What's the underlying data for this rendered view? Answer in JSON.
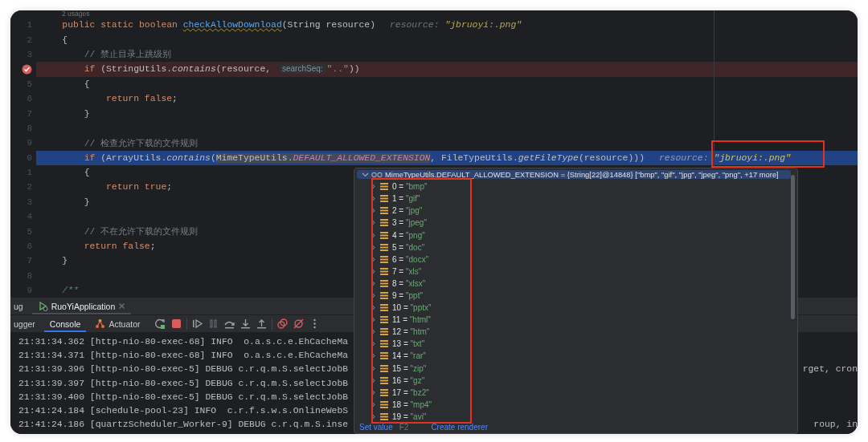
{
  "editor": {
    "usages_hint": "2 usages",
    "lines": [
      {
        "number": "1",
        "breakpoint": false,
        "current": false,
        "tokens": [
          {
            "kind": "keyword",
            "text": "    public static boolean "
          },
          {
            "kind": "declaration",
            "text": "checkAllowDownload"
          },
          {
            "kind": "plain",
            "text": "(String resource)"
          }
        ],
        "inline_value": {
          "name": "resource:",
          "value": "\"jbruoyi:.png\""
        }
      },
      {
        "number": "2",
        "breakpoint": false,
        "current": false,
        "tokens": [
          {
            "kind": "plain",
            "text": "    {"
          }
        ]
      },
      {
        "number": "3",
        "breakpoint": false,
        "current": false,
        "tokens": [
          {
            "kind": "comment",
            "text": "        // 禁止目录上跳级别"
          }
        ]
      },
      {
        "breakpoint": true,
        "current": false,
        "tokens": [
          {
            "kind": "keyword",
            "text": "        if"
          },
          {
            "kind": "plain",
            "text": " (StringUtils."
          },
          {
            "kind": "call",
            "text": "contains"
          },
          {
            "kind": "plain",
            "text": "(resource, "
          },
          {
            "kind": "param-hint",
            "text": "searchSeq:"
          },
          {
            "kind": "string",
            "text": "\"..\""
          },
          {
            "kind": "plain",
            "text": "))"
          }
        ]
      },
      {
        "number": "5",
        "breakpoint": false,
        "current": false,
        "tokens": [
          {
            "kind": "plain",
            "text": "        {"
          }
        ]
      },
      {
        "number": "6",
        "breakpoint": false,
        "current": false,
        "tokens": [
          {
            "kind": "keyword",
            "text": "            return false"
          },
          {
            "kind": "plain",
            "text": ";"
          }
        ]
      },
      {
        "number": "7",
        "breakpoint": false,
        "current": false,
        "tokens": [
          {
            "kind": "plain",
            "text": "        }"
          }
        ]
      },
      {
        "number": "8",
        "breakpoint": false,
        "current": false
      },
      {
        "number": "9",
        "breakpoint": false,
        "current": false,
        "tokens": [
          {
            "kind": "comment",
            "text": "        // 检查允许下载的文件规则"
          }
        ]
      },
      {
        "number": "0",
        "breakpoint": false,
        "current": true,
        "tokens": [
          {
            "kind": "keyword",
            "text": "        if"
          },
          {
            "kind": "plain",
            "text": " (ArrayUtils."
          },
          {
            "kind": "call",
            "text": "contains"
          },
          {
            "kind": "plain",
            "text": "("
          },
          {
            "kind": "expr",
            "text": "MimeTypeUtils."
          },
          {
            "kind": "expr-constant",
            "text": "DEFAULT_ALLOWED_EXTENSION"
          },
          {
            "kind": "plain",
            "text": ", FileTypeUtils."
          },
          {
            "kind": "call",
            "text": "getFileType"
          },
          {
            "kind": "plain",
            "text": "(resource)))"
          }
        ],
        "inline_value": {
          "name": "resource:",
          "value": "\"jbruoyi:.png\""
        }
      },
      {
        "number": "1",
        "breakpoint": false,
        "current": false,
        "tokens": [
          {
            "kind": "plain",
            "text": "        {"
          }
        ]
      },
      {
        "number": "2",
        "breakpoint": false,
        "current": false,
        "tokens": [
          {
            "kind": "keyword",
            "text": "            return true"
          },
          {
            "kind": "plain",
            "text": ";"
          }
        ]
      },
      {
        "number": "3",
        "breakpoint": false,
        "current": false,
        "tokens": [
          {
            "kind": "plain",
            "text": "        }"
          }
        ]
      },
      {
        "number": "4",
        "breakpoint": false,
        "current": false
      },
      {
        "number": "5",
        "breakpoint": false,
        "current": false,
        "tokens": [
          {
            "kind": "comment",
            "text": "        // 不在允许下载的文件规则"
          }
        ]
      },
      {
        "number": "6",
        "breakpoint": false,
        "current": false,
        "tokens": [
          {
            "kind": "keyword",
            "text": "        return false"
          },
          {
            "kind": "plain",
            "text": ";"
          }
        ]
      },
      {
        "number": "7",
        "breakpoint": false,
        "current": false,
        "tokens": [
          {
            "kind": "plain",
            "text": "    }"
          }
        ]
      },
      {
        "number": "8",
        "breakpoint": false,
        "current": false
      },
      {
        "number": "9",
        "breakpoint": false,
        "current": false,
        "tokens": [
          {
            "kind": "doc-comment",
            "text": "    /**"
          }
        ]
      }
    ]
  },
  "debug_panel": {
    "tabs": [
      {
        "label": "ug",
        "selected": false
      },
      {
        "label": "RuoYiApplication",
        "selected": true
      }
    ],
    "subtabs": [
      {
        "label": "ugger",
        "selected": false
      },
      {
        "label": "Console",
        "selected": true
      },
      {
        "label": "Actuator",
        "selected": false
      }
    ],
    "log_lines": [
      {
        "text": "21:31:34.362 [http-nio-80-exec-68] INFO  o.a.s.c.e.EhCacheMa"
      },
      {
        "text": "21:31:34.371 [http-nio-80-exec-68] INFO  o.a.s.c.e.EhCacheMa"
      },
      {
        "text": "21:31:39.396 [http-nio-80-exec-5] DEBUG c.r.q.m.S.selectJobB",
        "tail": "rget, cron"
      },
      {
        "text": "21:31:39.397 [http-nio-80-exec-5] DEBUG c.r.q.m.S.selectJobB"
      },
      {
        "text": "21:31:39.400 [http-nio-80-exec-5] DEBUG c.r.q.m.S.selectJobB"
      },
      {
        "text": "21:41:24.184 [schedule-pool-23] INFO  c.r.f.s.w.s.OnlineWebS"
      },
      {
        "text": "21:41:24.186 [quartzScheduler_Worker-9] DEBUG c.r.q.m.S.inse",
        "tail": "roup, in"
      }
    ]
  },
  "value_popup": {
    "header": {
      "expanded": true,
      "text": "MimeTypeUtils.DEFAULT_ALLOWED_EXTENSION = {String[22]@14848} [\"bmp\", \"gif\", \"jpg\", \"jpeg\", \"png\", +17 more]"
    },
    "items": [
      {
        "name": "0 =",
        "value": "\"bmp\"",
        "expanded": false
      },
      {
        "name": "1 =",
        "value": "\"gif\"",
        "expanded": false
      },
      {
        "name": "2 =",
        "value": "\"jpg\"",
        "expanded": false
      },
      {
        "name": "3 =",
        "value": "\"jpeg\"",
        "expanded": false
      },
      {
        "name": "4 =",
        "value": "\"png\"",
        "expanded": false
      },
      {
        "name": "5 =",
        "value": "\"doc\"",
        "expanded": false
      },
      {
        "name": "6 =",
        "value": "\"docx\"",
        "expanded": false
      },
      {
        "name": "7 =",
        "value": "\"xls\"",
        "expanded": false
      },
      {
        "name": "8 =",
        "value": "\"xlsx\"",
        "expanded": false
      },
      {
        "name": "9 =",
        "value": "\"ppt\"",
        "expanded": false
      },
      {
        "name": "10 =",
        "value": "\"pptx\"",
        "expanded": false
      },
      {
        "name": "11 =",
        "value": "\"html\"",
        "expanded": false
      },
      {
        "name": "12 =",
        "value": "\"htm\"",
        "expanded": false
      },
      {
        "name": "13 =",
        "value": "\"txt\"",
        "expanded": false
      },
      {
        "name": "14 =",
        "value": "\"rar\"",
        "expanded": false
      },
      {
        "name": "15 =",
        "value": "\"zip\"",
        "expanded": false
      },
      {
        "name": "16 =",
        "value": "\"gz\"",
        "expanded": false
      },
      {
        "name": "17 =",
        "value": "\"bz2\"",
        "expanded": false
      },
      {
        "name": "18 =",
        "value": "\"mp4\"",
        "expanded": false
      },
      {
        "name": "19 =",
        "value": "\"avi\"",
        "expanded": false
      }
    ],
    "actions": [
      {
        "label": "Set value",
        "shortcut": "F2"
      },
      {
        "label": "Create renderer"
      }
    ]
  }
}
